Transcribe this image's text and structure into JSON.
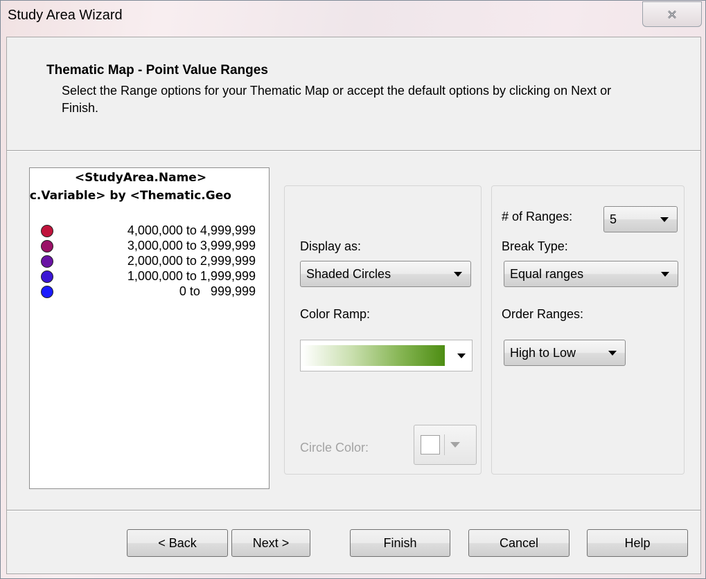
{
  "window": {
    "title": "Study Area Wizard",
    "close_icon": "close-x-icon"
  },
  "header": {
    "title": "Thematic Map - Point Value Ranges",
    "description": "Select the Range options for your Thematic Map or accept the default options by clicking on Next or Finish."
  },
  "legend": {
    "title": "<StudyArea.Name>",
    "subtitle": "ic.Variable> by <Thematic.Geo",
    "rows": [
      {
        "label": "4,000,000 to 4,999,999",
        "color": "#c0143c"
      },
      {
        "label": "3,000,000 to 3,999,999",
        "color": "#9a1267"
      },
      {
        "label": "2,000,000 to 2,999,999",
        "color": "#6a14a4"
      },
      {
        "label": "1,000,000 to 1,999,999",
        "color": "#3b16d4"
      },
      {
        "label": "0 to   999,999",
        "color": "#1b1bff"
      }
    ]
  },
  "display": {
    "display_as_label": "Display as:",
    "display_as_value": "Shaded Circles",
    "color_ramp_label": "Color Ramp:",
    "color_ramp_start": "#ffffff",
    "color_ramp_end": "#4d8d13",
    "circle_color_label": "Circle Color:"
  },
  "ranges": {
    "num_ranges_label": "# of Ranges:",
    "num_ranges_value": "5",
    "break_type_label": "Break Type:",
    "break_type_value": "Equal ranges",
    "order_ranges_label": "Order Ranges:",
    "order_ranges_value": "High to Low"
  },
  "buttons": {
    "back": "< Back",
    "next": "Next >",
    "finish": "Finish",
    "cancel": "Cancel",
    "help": "Help"
  }
}
